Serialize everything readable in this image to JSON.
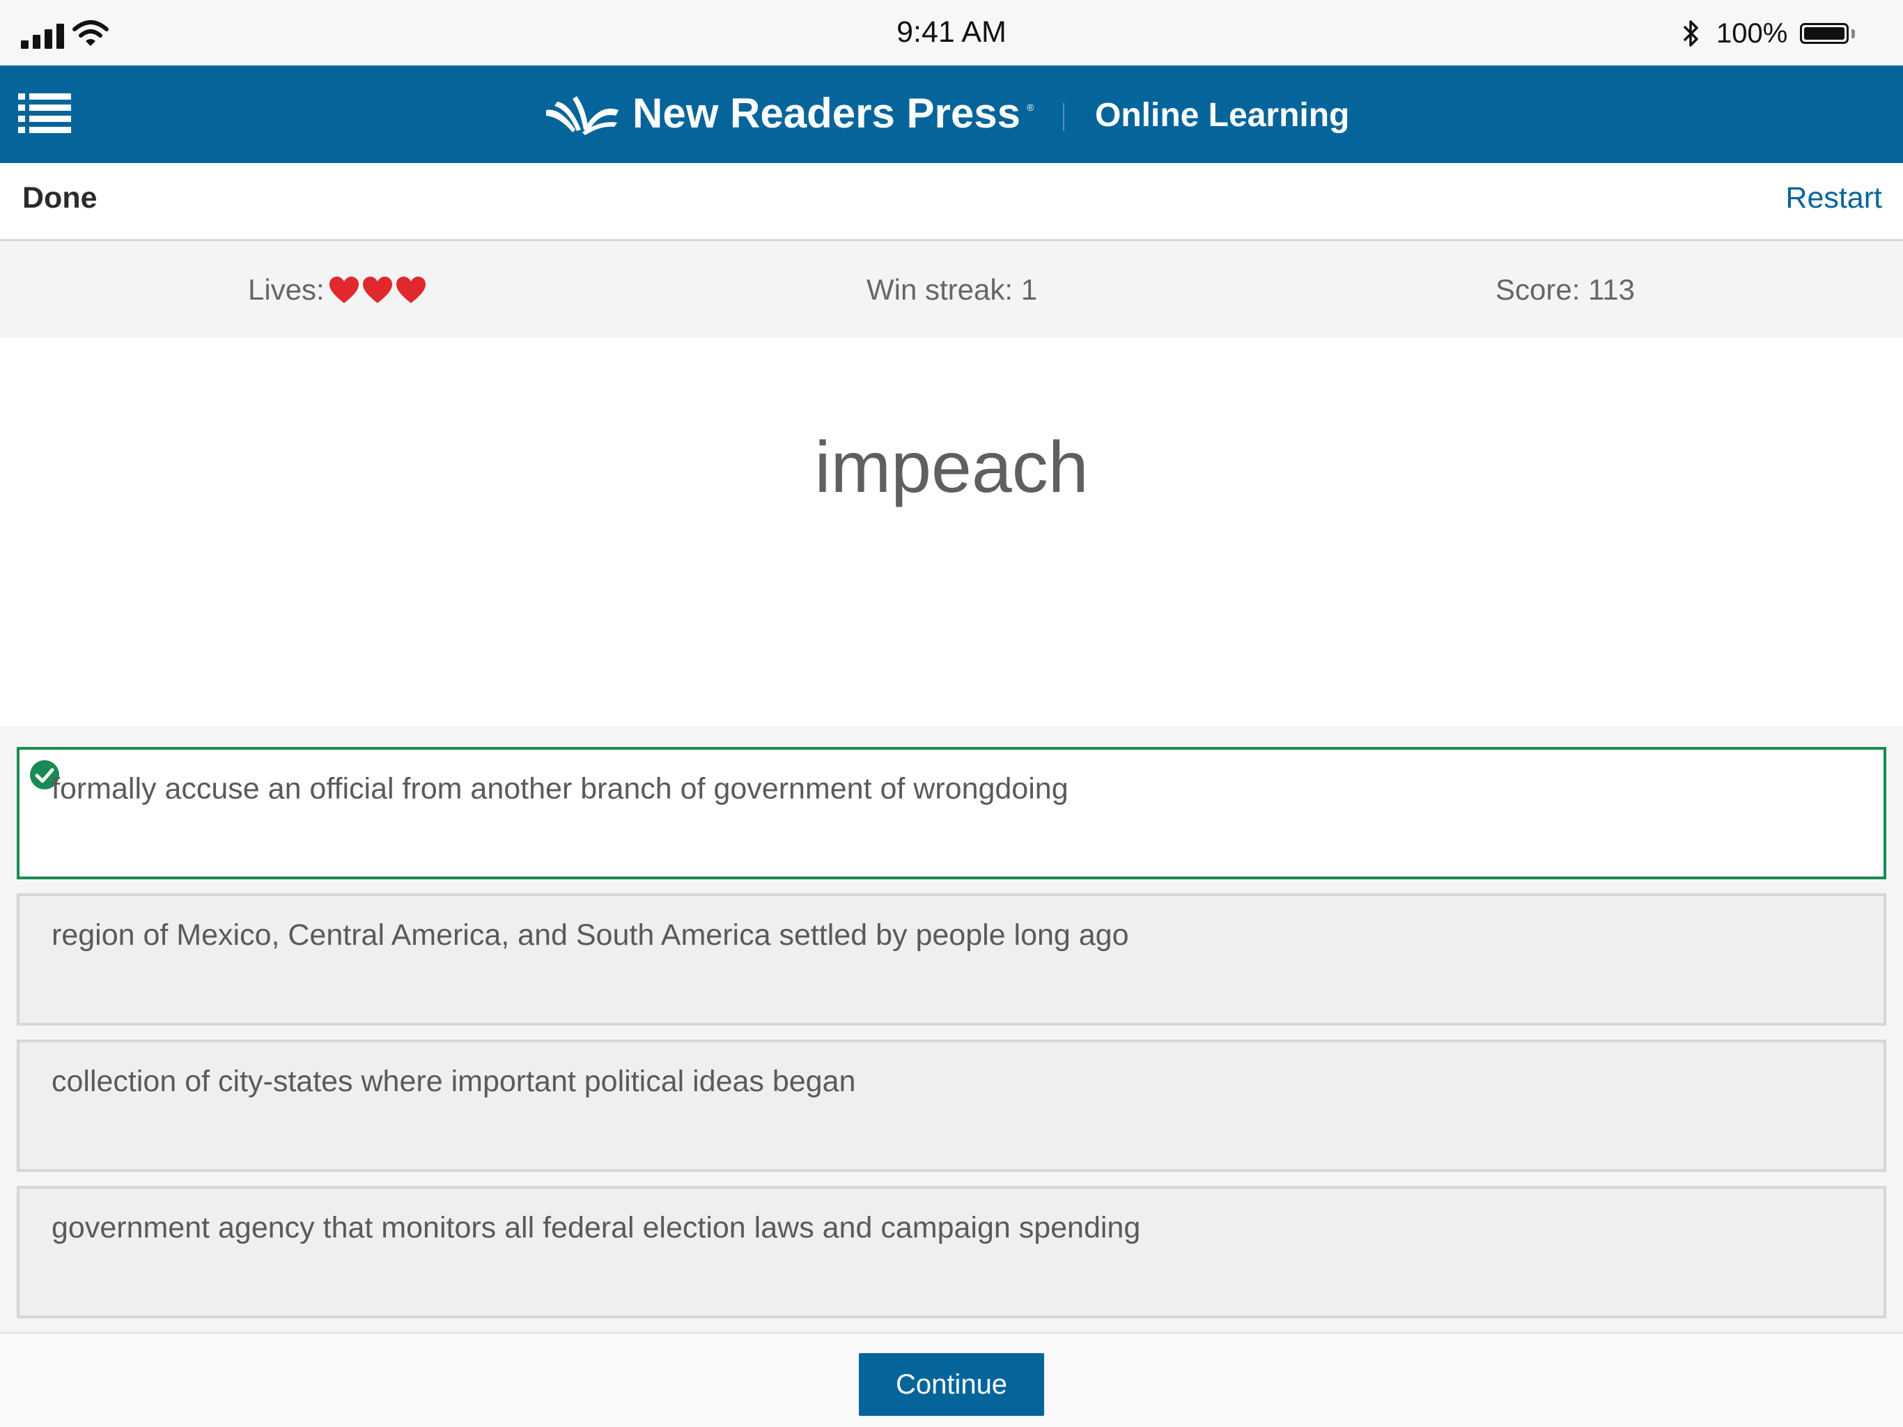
{
  "status_bar": {
    "time": "9:41 AM",
    "battery_percent": "100%",
    "icons": [
      "signal-icon",
      "wifi-icon",
      "bluetooth-icon",
      "battery-icon"
    ]
  },
  "header": {
    "brand": "New Readers Press",
    "product": "Online Learning",
    "icons": [
      "menu-list-icon",
      "open-book-logo-icon"
    ],
    "background_color": "#05659b"
  },
  "toolbar": {
    "done_label": "Done",
    "restart_label": "Restart",
    "restart_color": "#05659b"
  },
  "stats": {
    "lives_label": "Lives:",
    "lives_count": 3,
    "heart_color": "#e0282e",
    "win_streak": "Win streak: 1",
    "score": "Score: 113"
  },
  "question": {
    "word": "impeach"
  },
  "choices": [
    {
      "text": "formally accuse an official from another branch of government of wrongdoing",
      "state": "correct"
    },
    {
      "text": "region of Mexico, Central America, and South America settled by people long ago",
      "state": "default"
    },
    {
      "text": "collection of city-states where important political ideas began",
      "state": "default"
    },
    {
      "text": "government agency that monitors all federal election laws and campaign spending",
      "state": "default"
    }
  ],
  "colors": {
    "correct_border": "#1a8a55",
    "choice_border": "#d6d6d6"
  },
  "footer": {
    "continue_label": "Continue"
  }
}
